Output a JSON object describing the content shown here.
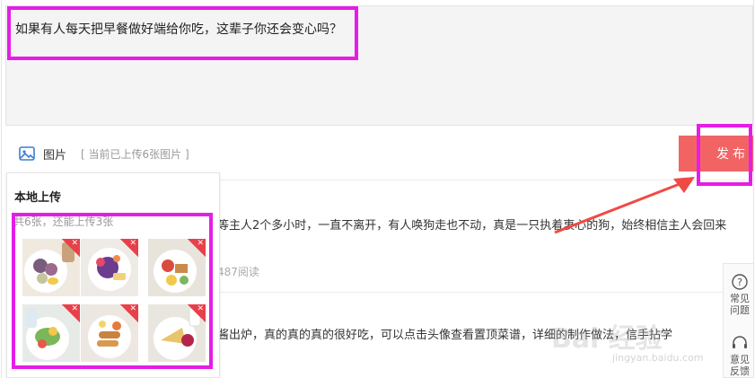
{
  "composer": {
    "text": "如果有人每天把早餐做好端给你吃，这辈子你还会变心吗？",
    "image_button_label": "图片",
    "upload_status": "[ 当前已上传6张图片 ]",
    "publish_label": "发布"
  },
  "upload_panel": {
    "title": "本地上传",
    "subtitle": "共6张，还能上传3张",
    "thumbnails": [
      {
        "name": "breakfast-photo-1"
      },
      {
        "name": "breakfast-photo-2"
      },
      {
        "name": "breakfast-photo-3"
      },
      {
        "name": "breakfast-photo-4"
      },
      {
        "name": "breakfast-photo-5"
      },
      {
        "name": "breakfast-photo-6"
      }
    ]
  },
  "feed": {
    "items": [
      {
        "text": "等主人2个多小时，一直不离开，有人唤狗走也不动，真是一只执着衷心的狗，始终相信主人会回来",
        "meta": "487阅读"
      },
      {
        "text": "酱出炉，真的真的真的很好吃，可以点击头像查看置顶菜谱，详细的制作做法，信手拈学",
        "meta": ""
      }
    ]
  },
  "side_tools": {
    "faq_label_1": "常见",
    "faq_label_2": "问题",
    "feedback_label_1": "意见",
    "feedback_label_2": "反馈"
  },
  "watermark": {
    "logo": "Bai 经验",
    "url": "jingyan.baidu.com"
  },
  "colors": {
    "publish_button": "#f26464",
    "highlight": "#e51de6",
    "delete_badge": "#e8404a"
  }
}
